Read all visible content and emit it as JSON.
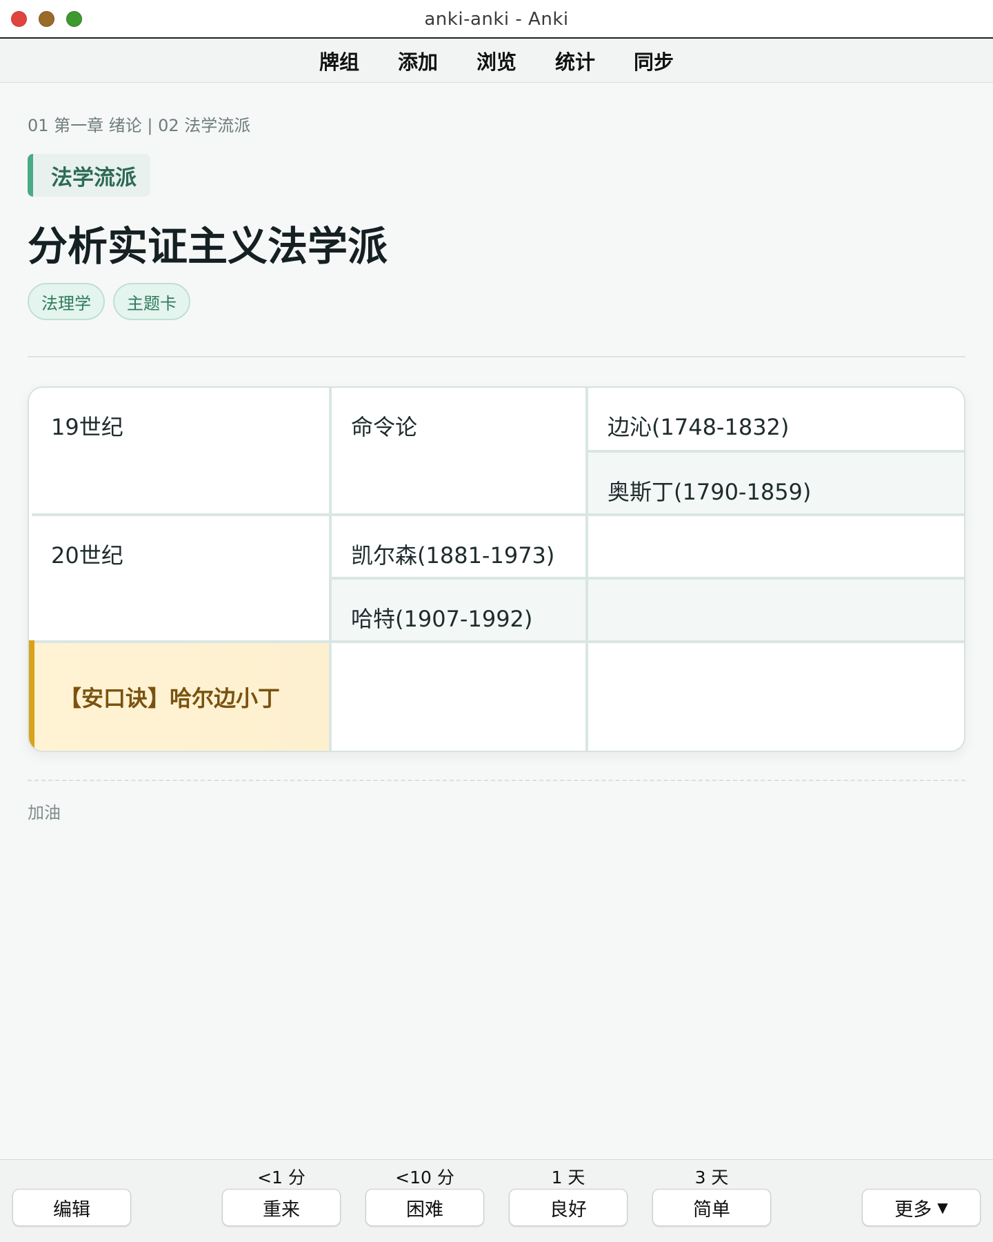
{
  "window": {
    "title": "anki-anki - Anki"
  },
  "toolbar": {
    "items": [
      "牌组",
      "添加",
      "浏览",
      "统计",
      "同步"
    ]
  },
  "card": {
    "breadcrumb": "01 第一章 绪论 | 02 法学流派",
    "topic_tag": "法学流派",
    "title": "分析实证主义法学派",
    "chips": [
      "法理学",
      "主题卡"
    ],
    "table": {
      "r1c1": "19世纪",
      "r1c2": "命令论",
      "r1c3": "边沁(1748-1832)",
      "r2c3": "奥斯丁(1790-1859)",
      "r3c1": "20世纪",
      "r3c2": "凯尔森(1881-1973)",
      "r4c2": "哈特(1907-1992)",
      "mnemonic": "【安口诀】哈尔边小丁"
    },
    "note": "加油"
  },
  "bottom": {
    "edit": "编辑",
    "more": "更多",
    "answers": [
      {
        "interval": "<1 分",
        "label": "重来"
      },
      {
        "interval": "<10 分",
        "label": "困难"
      },
      {
        "interval": "1 天",
        "label": "良好"
      },
      {
        "interval": "3 天",
        "label": "简单"
      }
    ]
  }
}
